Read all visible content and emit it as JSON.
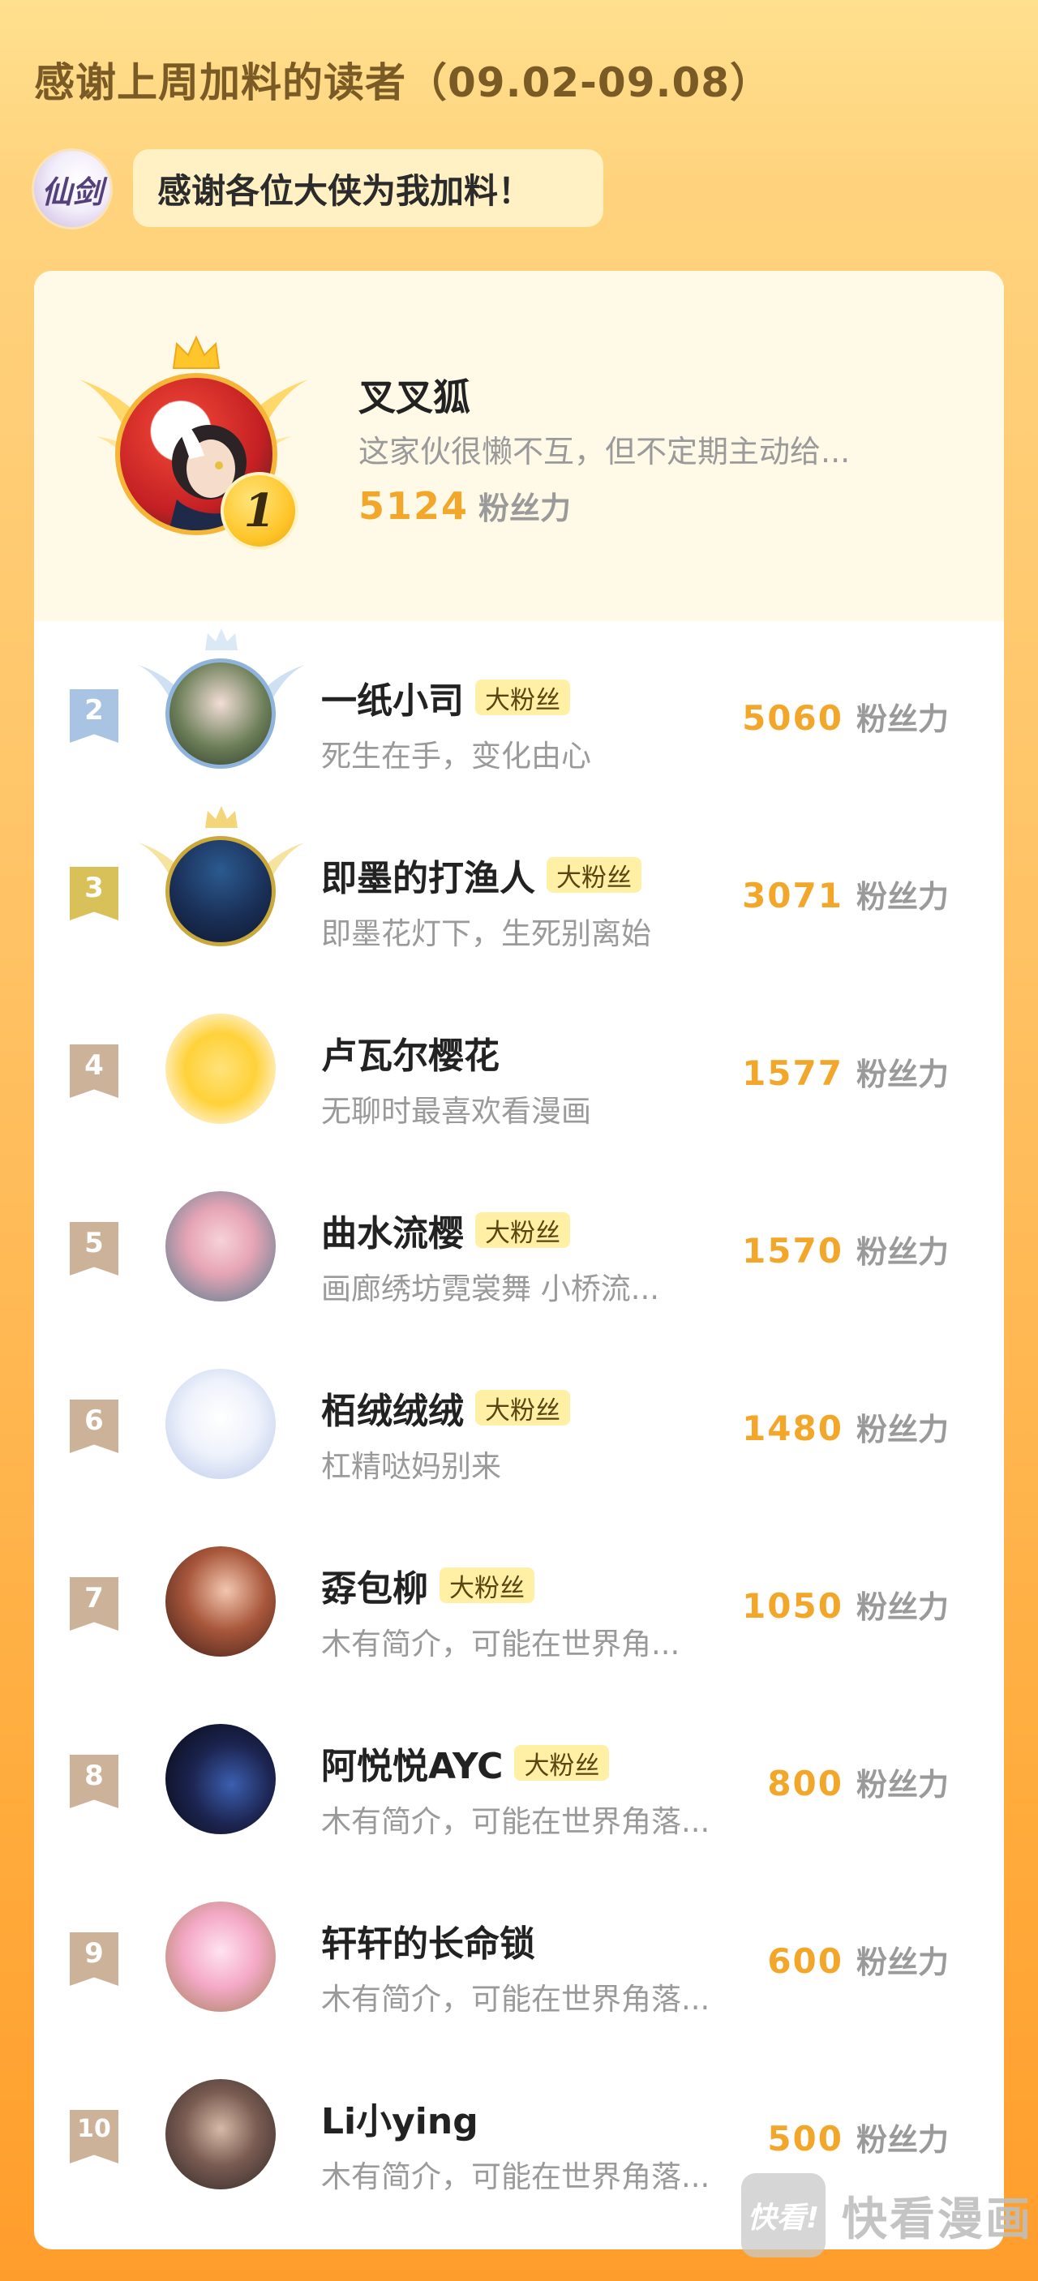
{
  "header": {
    "title": "感谢上周加料的读者（09.02-09.08）",
    "host_logo_text": "仙剑",
    "bubble_text": "感谢各位大侠为我加料！"
  },
  "top_reader": {
    "rank": "1",
    "name": "叉叉狐",
    "bio": "这家伙很懒不互，但不定期主动给...",
    "score": "5124",
    "unit": "粉丝力"
  },
  "readers": [
    {
      "rank": "2",
      "name": "一纸小司",
      "badge": "大粉丝",
      "bio": "死生在手，变化由心",
      "score": "5060",
      "unit": "粉丝力"
    },
    {
      "rank": "3",
      "name": "即墨的打渔人",
      "badge": "大粉丝",
      "bio": "即墨花灯下，生死别离始",
      "score": "3071",
      "unit": "粉丝力"
    },
    {
      "rank": "4",
      "name": "卢瓦尔樱花",
      "badge": "",
      "bio": "无聊时最喜欢看漫画",
      "score": "1577",
      "unit": "粉丝力"
    },
    {
      "rank": "5",
      "name": "曲水流樱",
      "badge": "大粉丝",
      "bio": "画廊绣坊霓裳舞 小桥流...",
      "score": "1570",
      "unit": "粉丝力"
    },
    {
      "rank": "6",
      "name": "栢绒绒绒",
      "badge": "大粉丝",
      "bio": "杠精哒妈别来",
      "score": "1480",
      "unit": "粉丝力"
    },
    {
      "rank": "7",
      "name": "孬包柳",
      "badge": "大粉丝",
      "bio": "木有简介，可能在世界角...",
      "score": "1050",
      "unit": "粉丝力"
    },
    {
      "rank": "8",
      "name": "阿悦悦AYC",
      "badge": "大粉丝",
      "bio": "木有简介，可能在世界角落...",
      "score": "800",
      "unit": "粉丝力"
    },
    {
      "rank": "9",
      "name": "轩轩的长命锁",
      "badge": "",
      "bio": "木有简介，可能在世界角落...",
      "score": "600",
      "unit": "粉丝力"
    },
    {
      "rank": "10",
      "name": "Li小ying",
      "badge": "",
      "bio": "木有简介，可能在世界角落...",
      "score": "500",
      "unit": "粉丝力"
    }
  ],
  "watermark": {
    "logo_text": "快看!",
    "brand": "快看漫画"
  },
  "colors": {
    "accent_orange": "#f2a72a",
    "rank2_tag": "#a9c4e2",
    "rank3_tag": "#d9c15a",
    "rank_other_tag": "#cdb29a",
    "fan_badge_bg": "#fff0a6"
  }
}
